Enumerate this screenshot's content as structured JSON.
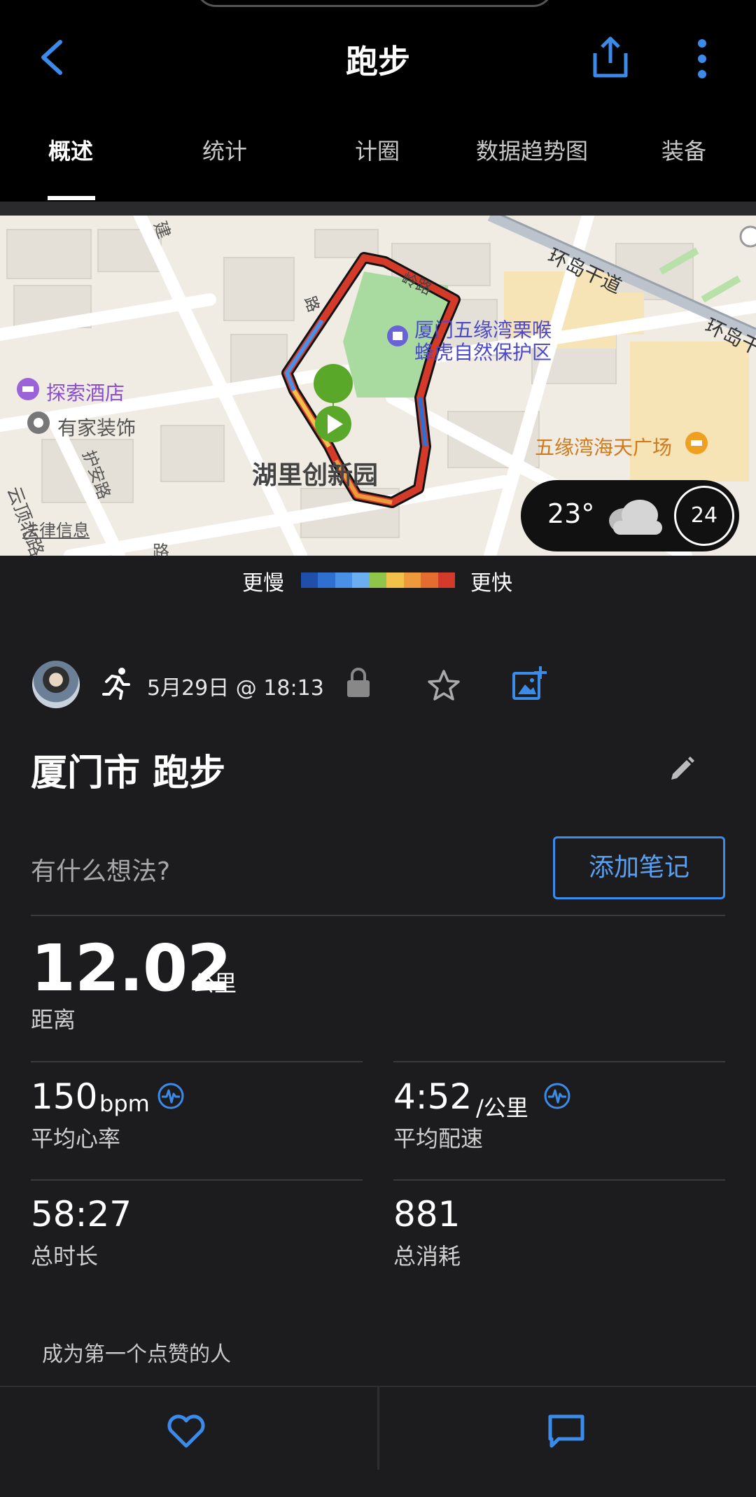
{
  "header": {
    "title": "跑步",
    "back_icon": "chevron-left-icon",
    "share_icon": "share-icon",
    "more_icon": "more-vertical-icon"
  },
  "tabs": [
    {
      "label": "概述",
      "active": true
    },
    {
      "label": "统计",
      "active": false
    },
    {
      "label": "计圈",
      "active": false
    },
    {
      "label": "数据趋势图",
      "active": false
    },
    {
      "label": "装备",
      "active": false
    }
  ],
  "map": {
    "labels": {
      "road_huandao": "环岛干道",
      "road_huandao2": "环岛干",
      "reserve_line1": "厦门五缘湾栗喉",
      "reserve_line2": "蜂虎自然保护区",
      "hotel": "探索酒店",
      "youjia": "有家装饰",
      "park": "湖里创新园",
      "plaza": "五缘湾海天广场",
      "huan_road": "护安路",
      "yunding": "云顶北路",
      "legal": "法律信息",
      "road_top": "建",
      "road_ling": "岭路",
      "road_left": "路",
      "road_bottom": "路"
    },
    "weather": {
      "temperature": "23°",
      "icon": "cloud-icon",
      "badge": "24"
    }
  },
  "pace_legend": {
    "slow_label": "更慢",
    "fast_label": "更快",
    "colors": [
      "#1f4fa8",
      "#2f6fd0",
      "#4a90e6",
      "#6aaef0",
      "#8fc64a",
      "#f2c14a",
      "#ee9a3c",
      "#e46c2f",
      "#d43a2a"
    ]
  },
  "activity": {
    "date": "5月29日 @ 18:13",
    "title": "厦门市 跑步",
    "note_prompt": "有什么想法?",
    "add_note_label": "添加笔记"
  },
  "stats": {
    "distance": {
      "value": "12.02",
      "unit": "公里",
      "label": "距离"
    },
    "heart_rate": {
      "value": "150",
      "unit": "bpm",
      "label": "平均心率"
    },
    "pace": {
      "value": "4:52",
      "unit": "/公里",
      "label": "平均配速"
    },
    "duration": {
      "value": "58:27",
      "label": "总时长"
    },
    "calories": {
      "value": "881",
      "label": "总消耗"
    }
  },
  "social": {
    "likes_text": "成为第一个点赞的人"
  },
  "colors": {
    "accent": "#3b8bea",
    "background": "#1c1c1e",
    "header": "#000000"
  }
}
